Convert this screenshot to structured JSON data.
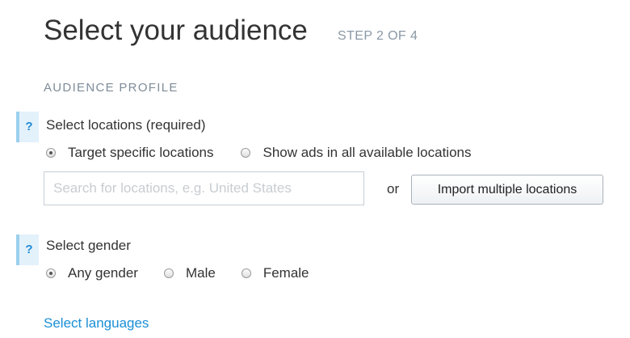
{
  "page": {
    "title": "Select your audience",
    "step": "STEP 2 OF 4"
  },
  "audience_profile": {
    "section_title": "AUDIENCE PROFILE",
    "locations": {
      "help_label": "?",
      "label": "Select locations (required)",
      "options": [
        {
          "label": "Target specific locations",
          "selected": true
        },
        {
          "label": "Show ads in all available locations",
          "selected": false
        }
      ],
      "search_placeholder": "Search for locations, e.g. United States",
      "search_value": "",
      "or_text": "or",
      "import_button": "Import multiple locations"
    },
    "gender": {
      "help_label": "?",
      "label": "Select gender",
      "options": [
        {
          "label": "Any gender",
          "selected": true
        },
        {
          "label": "Male",
          "selected": false
        },
        {
          "label": "Female",
          "selected": false
        }
      ]
    },
    "languages_link": "Select languages"
  },
  "colors": {
    "accent": "#1b8fd6",
    "help_bg": "#e3f1fb",
    "help_border": "#9cd0ee"
  }
}
